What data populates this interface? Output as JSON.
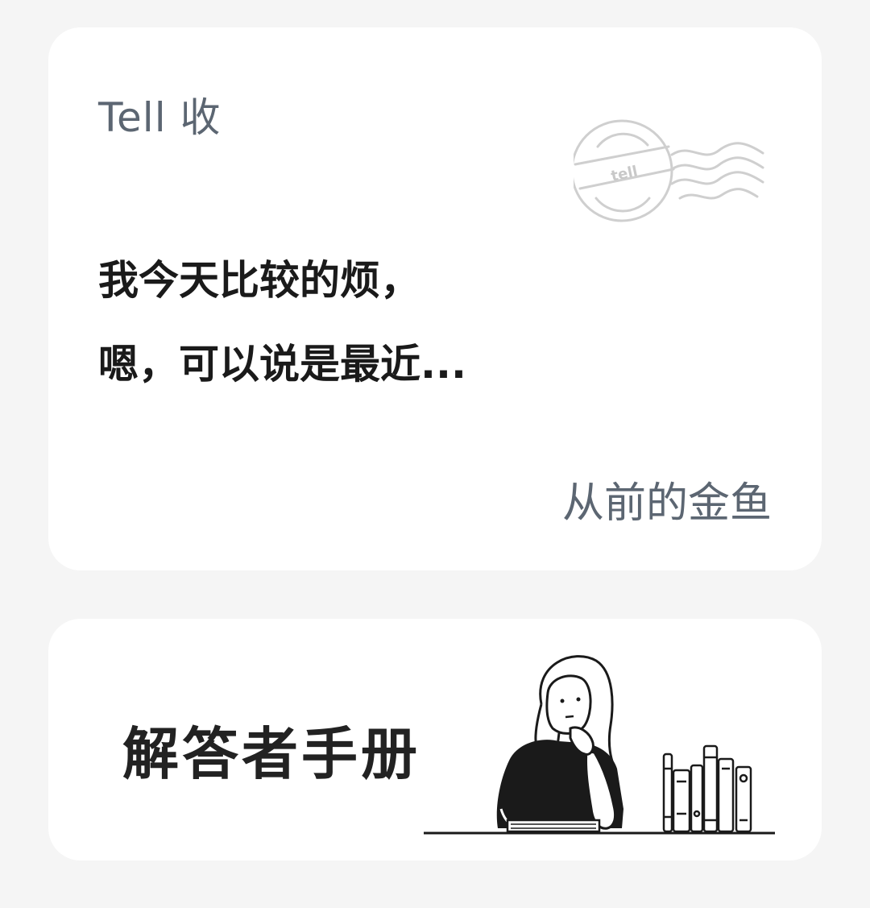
{
  "letter_card": {
    "header": "Tell 收",
    "postmark_text": "tell",
    "message_lines": [
      "我今天比较的烦，",
      "嗯，可以说是最近..."
    ],
    "sender": "从前的金鱼"
  },
  "handbook_card": {
    "title": "解答者手册"
  },
  "colors": {
    "page_bg": "#f5f5f5",
    "card_bg": "#ffffff",
    "muted_text": "#5c6672",
    "primary_text": "#1a1a1a"
  },
  "icons": {
    "postmark": "postmark-stamp-icon",
    "illustration": "reading-person-with-books-illustration"
  }
}
